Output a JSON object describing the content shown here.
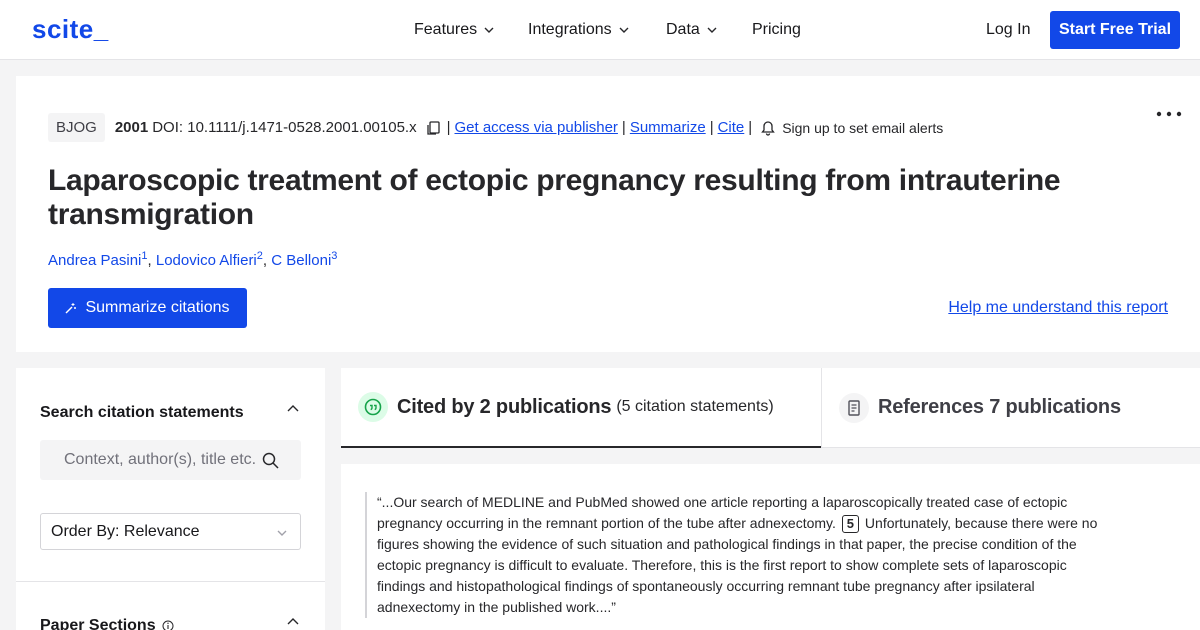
{
  "nav": {
    "logo": "scite_",
    "features": "Features",
    "integrations": "Integrations",
    "data": "Data",
    "pricing": "Pricing",
    "login": "Log In",
    "trial": "Start Free Trial"
  },
  "paper": {
    "journal": "BJOG",
    "year": "2001",
    "doi": "DOI: 10.1111/j.1471-0528.2001.00105.x",
    "access_link": "Get access via publisher",
    "summarize_link": "Summarize",
    "cite_link": "Cite",
    "alerts": "Sign up to set email alerts",
    "title": "Laparoscopic treatment of ectopic pregnancy resulting from intrauterine transmigration",
    "authors": [
      {
        "name": "Andrea Pasini",
        "sup": "1"
      },
      {
        "name": "Lodovico Alfieri",
        "sup": "2"
      },
      {
        "name": "C Belloni",
        "sup": "3"
      }
    ],
    "summarize_button": "Summarize citations",
    "help_link": "Help me understand this report"
  },
  "sidebar": {
    "search_title": "Search citation statements",
    "search_placeholder": "Context, author(s), title etc.",
    "order_by": "Order By: Relevance",
    "sections_title": "Paper Sections"
  },
  "tabs": {
    "cited_main": "Cited by 2 publications",
    "cited_sub": "(5 citation statements)",
    "refs_main": "References 7 publications"
  },
  "citation": {
    "text_before": "“...Our search of MEDLINE and PubMed showed one article reporting a laparoscopically treated case of ectopic pregnancy occurring in the remnant portion of the tube after adnexectomy.",
    "ref": "5",
    "text_after": "Unfortunately, because there were no figures showing the evidence of such situation and pathological findings in that paper, the precise condition of the ectopic pregnancy is difficult to evaluate. Therefore, this is the first report to show complete sets of laparoscopic findings and histopathological findings of spontaneously occurring remnant tube pregnancy after ipsilateral adnexectomy in the published work....”"
  },
  "colors": {
    "brand": "#1248e8",
    "cited_icon_bg": "#dcfce7",
    "cited_icon": "#16a34a"
  }
}
